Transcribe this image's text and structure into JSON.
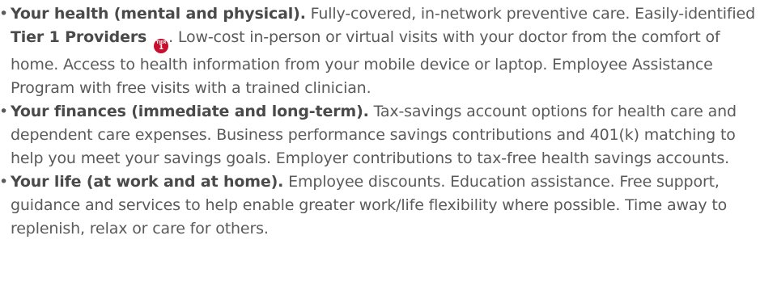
{
  "benefits": [
    {
      "lead": "Your health (mental and physical).",
      "text_before_tier": " Fully-covered, in-network preventive care. Easily-identified ",
      "tier_label": "Tier 1 Providers",
      "tier_badge_top": "TIER",
      "tier_badge_num": "1",
      "text_after_tier": ". Low-cost in-person or virtual visits with your doctor from the comfort of home. Access to health information from your mobile device or laptop. Employee Assistance Program with free visits with a trained clinician."
    },
    {
      "lead": "Your finances (immediate and long-term).",
      "text": " Tax-savings account options for health care and dependent care expenses. Business performance savings contributions and 401(k) matching to help you meet your savings goals. Employer contributions to tax-free health savings accounts."
    },
    {
      "lead": "Your life (at work and at home).",
      "text": " Employee discounts. Education assistance. Free support, guidance and services to help enable greater work/life flexibility where possible. Time away to replenish, relax or care for others."
    }
  ],
  "bullet_char": "•",
  "colors": {
    "text": "#5a5a5a",
    "lead": "#4a4a4a",
    "tier_badge": "#c8102e"
  }
}
